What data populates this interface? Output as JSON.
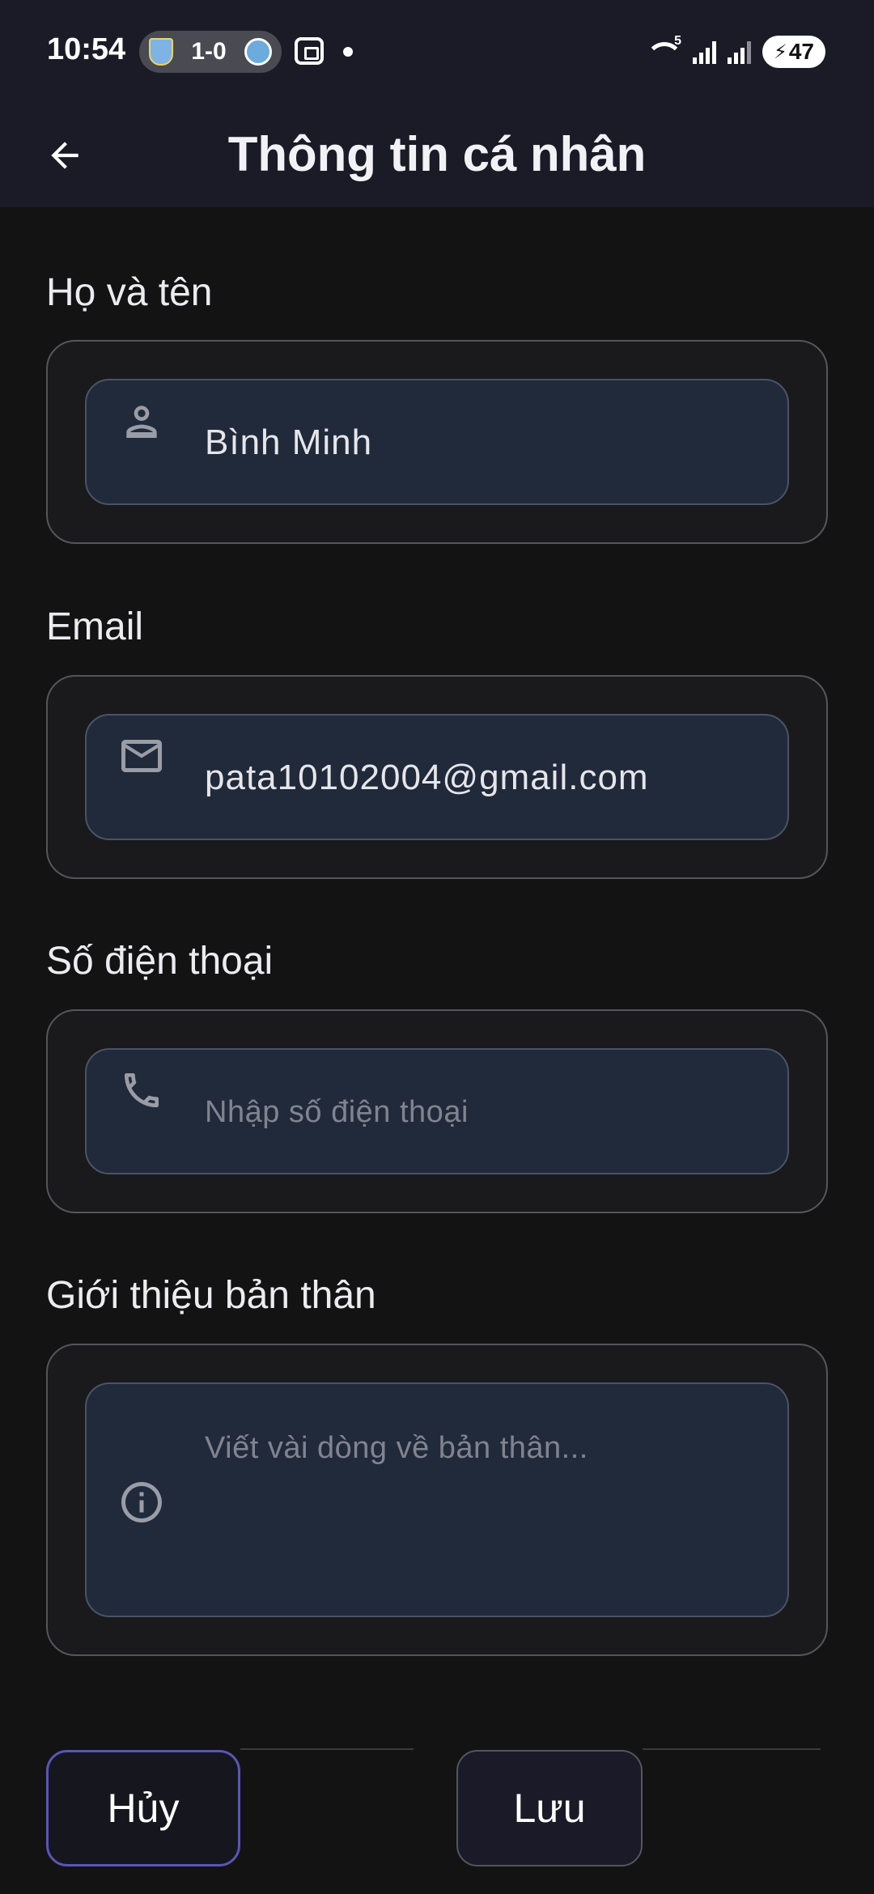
{
  "status_bar": {
    "time": "10:54",
    "score": "1-0",
    "battery": "47"
  },
  "app_bar": {
    "title": "Thông tin cá nhân"
  },
  "form": {
    "name": {
      "label": "Họ và tên",
      "value": "Bình Minh",
      "icon": "person-icon"
    },
    "email": {
      "label": "Email",
      "value": "pata10102004@gmail.com",
      "icon": "mail-icon"
    },
    "phone": {
      "label": "Số điện thoại",
      "placeholder": "Nhập số điện thoại",
      "icon": "phone-icon"
    },
    "bio": {
      "label": "Giới thiệu bản thân",
      "placeholder": "Viết vài dòng về bản thân...",
      "icon": "info-icon"
    }
  },
  "actions": {
    "cancel_label": "Hủy",
    "save_label": "Lưu"
  },
  "colors": {
    "background": "#131313",
    "bar": "#1b1b27",
    "input_fill": "#212a3a",
    "cancel_border": "#5b55b8"
  }
}
